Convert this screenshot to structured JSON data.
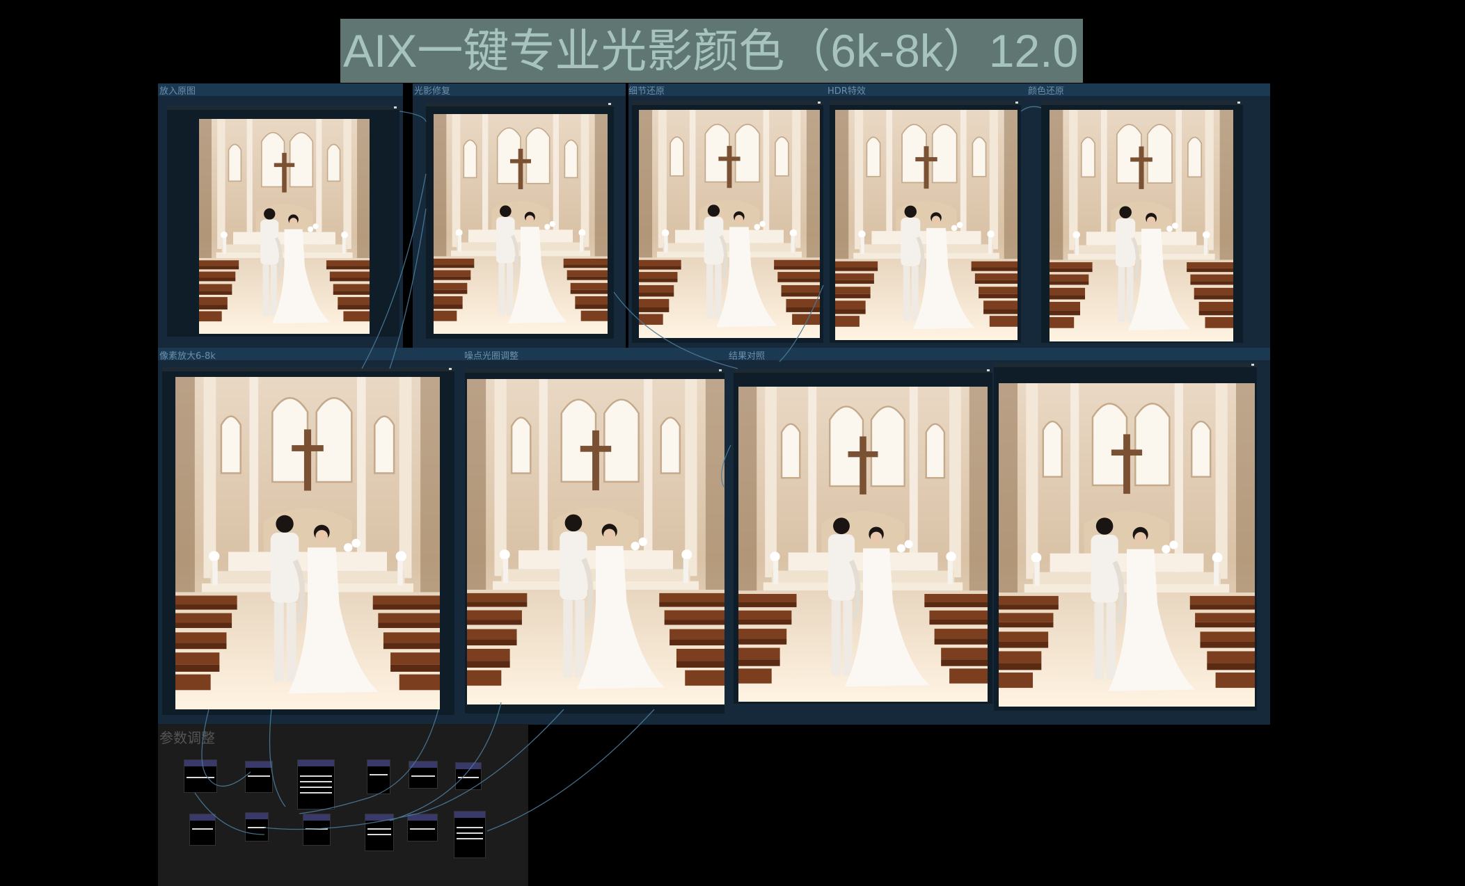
{
  "workflow": {
    "title": "AIX一键专业光影颜色（6k-8k）12.0"
  },
  "groups": [
    {
      "id": "g1",
      "label": "放入原图"
    },
    {
      "id": "g2",
      "label": "光影修复"
    },
    {
      "id": "g3",
      "label": "细节还原"
    },
    {
      "id": "g4",
      "label": "HDR特效"
    },
    {
      "id": "g5",
      "label": "颜色还原"
    },
    {
      "id": "g6",
      "label": "像素放大6-8k"
    },
    {
      "id": "g7",
      "label": "噪点光圈调整"
    },
    {
      "id": "g8",
      "label": "结果对照"
    }
  ],
  "params_group": {
    "label": "参数调整"
  },
  "colors": {
    "background": "#000000",
    "group_panel": "#15293a",
    "group_header": "#1b3a52",
    "title_banner": "#5f7673",
    "title_text": "#a6c3be",
    "wire": "#4a7a99"
  }
}
